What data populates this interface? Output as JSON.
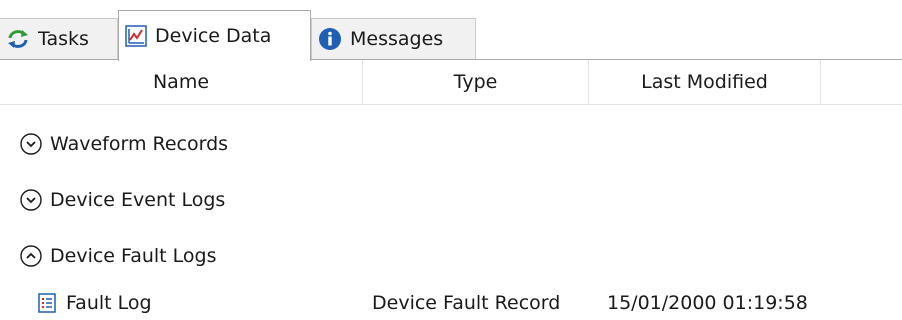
{
  "tabs": [
    {
      "label": "Tasks",
      "icon": "refresh-icon",
      "selected": false
    },
    {
      "label": "Device Data",
      "icon": "line-chart-icon",
      "selected": true
    },
    {
      "label": "Messages",
      "icon": "info-icon",
      "selected": false
    }
  ],
  "columns": {
    "name": "Name",
    "type": "Type",
    "modified": "Last Modified"
  },
  "groups": [
    {
      "label": "Waveform Records",
      "expanded": false
    },
    {
      "label": "Device Event Logs",
      "expanded": false
    },
    {
      "label": "Device Fault Logs",
      "expanded": true
    }
  ],
  "rows": [
    {
      "name": "Fault Log",
      "type": "Device Fault Record",
      "modified": "15/01/2000 01:19:58",
      "icon": "list-icon"
    }
  ],
  "colors": {
    "accent_blue": "#1e5fb4",
    "accent_red": "#d62b2b",
    "accent_green": "#2e9b3a"
  }
}
